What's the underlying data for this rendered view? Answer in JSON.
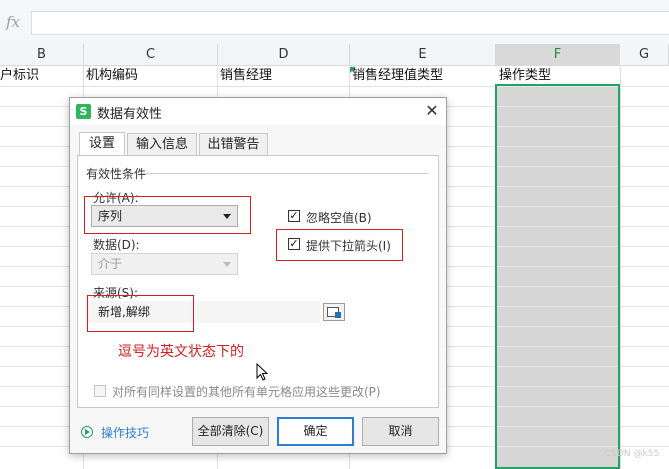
{
  "formula_bar": {
    "fx_label": "fx",
    "value": ""
  },
  "columns": [
    "B",
    "C",
    "D",
    "E",
    "F",
    "G"
  ],
  "row1_cells": [
    "户标识",
    "机构编码",
    "销售经理",
    "销售经理值类型",
    "操作类型"
  ],
  "dialog": {
    "title": "数据有效性",
    "logo_letter": "S",
    "tabs": [
      "设置",
      "输入信息",
      "出错警告"
    ],
    "section_title": "有效性条件",
    "allow_label": "允许(A):",
    "allow_value": "序列",
    "data_label": "数据(D):",
    "data_value": "介于",
    "ignore_blank_label": "忽略空值(B)",
    "ignore_blank_checked": true,
    "dropdown_label": "提供下拉箭头(I)",
    "dropdown_checked": true,
    "source_label": "来源(S):",
    "source_value": "新增,解绑",
    "apply_all_label": "对所有同样设置的其他所有单元格应用这些更改(P)",
    "apply_all_checked": false,
    "tips_label": "操作技巧",
    "clear_all_label": "全部清除(C)",
    "ok_label": "确定",
    "cancel_label": "取消",
    "check_glyph": "✓"
  },
  "annotation": "逗号为英文状态下的",
  "watermark": "CSDN @k55",
  "colors": {
    "accent_green": "#21a366",
    "annotation_red": "#d42020",
    "primary_blue": "#2f7dd3"
  }
}
